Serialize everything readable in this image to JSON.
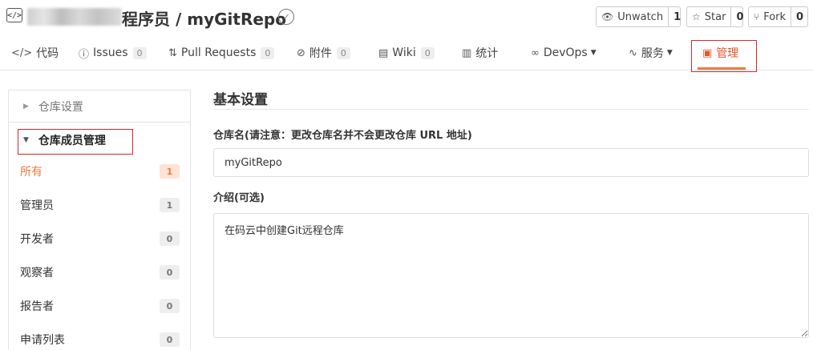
{
  "header": {
    "repo_name": "程序员 / myGitRepo",
    "watch_label": "Unwatch",
    "watch_count": "1",
    "star_label": "Star",
    "star_count": "0",
    "fork_label": "Fork",
    "fork_count": "0"
  },
  "tabs": [
    {
      "label": "代码",
      "icon": "code-icon"
    },
    {
      "label": "Issues",
      "count": "0",
      "icon": "issue-icon"
    },
    {
      "label": "Pull Requests",
      "count": "0",
      "icon": "pull-request-icon"
    },
    {
      "label": "附件",
      "count": "0",
      "icon": "attachment-icon"
    },
    {
      "label": "Wiki",
      "count": "0",
      "icon": "wiki-icon"
    },
    {
      "label": "统计",
      "icon": "bar-chart-icon"
    },
    {
      "label": "DevOps",
      "icon": "infinity-icon"
    },
    {
      "label": "服务",
      "icon": "pulse-icon"
    },
    {
      "label": "管理",
      "icon": "manage-icon"
    }
  ],
  "sidebar": {
    "repo_settings": "仓库设置",
    "member_management": "仓库成员管理",
    "items": [
      {
        "label": "所有",
        "count": "1"
      },
      {
        "label": "管理员",
        "count": "1"
      },
      {
        "label": "开发者",
        "count": "0"
      },
      {
        "label": "观察者",
        "count": "0"
      },
      {
        "label": "报告者",
        "count": "0"
      },
      {
        "label": "申请列表",
        "count": "0"
      }
    ]
  },
  "main": {
    "section_title": "基本设置",
    "name_label": "仓库名(请注意：更改仓库名并不会更改仓库 URL 地址)",
    "name_value": "myGitRepo",
    "desc_label": "介绍(可选)",
    "desc_value": "在码云中创建Git远程仓库"
  },
  "colors": {
    "accent": "#f1793f",
    "highlight_box": "#d9262e"
  }
}
